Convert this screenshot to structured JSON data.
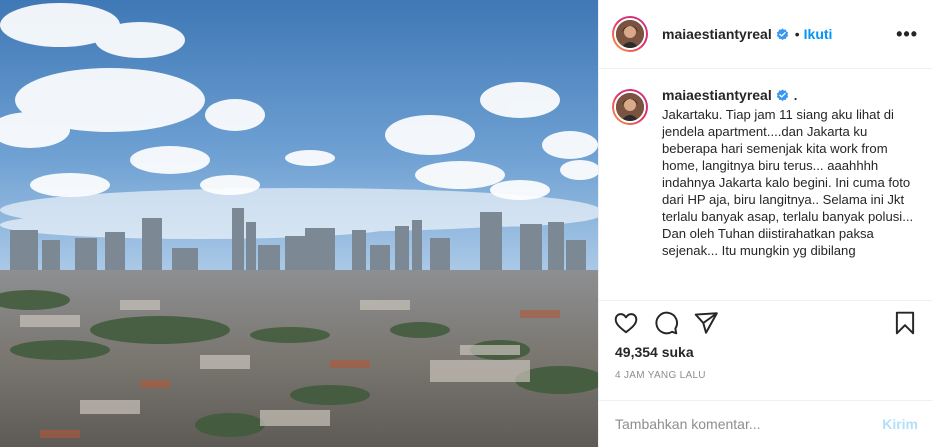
{
  "post": {
    "username": "maiaestiantyreal",
    "follow_label": "Ikuti",
    "dot": "•",
    "more_label": "•••",
    "caption_tail": ".",
    "caption": "Jakartaku. Tiap jam 11 siang aku lihat di jendela apartment....dan Jakarta ku beberapa hari semenjak kita work from home, langitnya biru terus... aaahhhh indahnya Jakarta kalo begini. Ini cuma foto dari HP aja, biru langitnya.. Selama ini Jkt terlalu banyak asap, terlalu banyak polusi... Dan oleh Tuhan diistirahatkan paksa sejenak... Itu mungkin yg dibilang",
    "likes": "49,354 suka",
    "timestamp": "4 JAM YANG LALU",
    "comment_placeholder": "Tambahkan komentar...",
    "post_button": "Kirim"
  },
  "icons": {
    "verified": "verified-badge-icon",
    "like": "heart-icon",
    "comment": "comment-icon",
    "share": "paper-plane-icon",
    "save": "bookmark-icon"
  },
  "colors": {
    "accent": "#0095f6",
    "verified": "#3897f0",
    "post_disabled": "#b2dffc",
    "muted": "#8e8e8e"
  }
}
